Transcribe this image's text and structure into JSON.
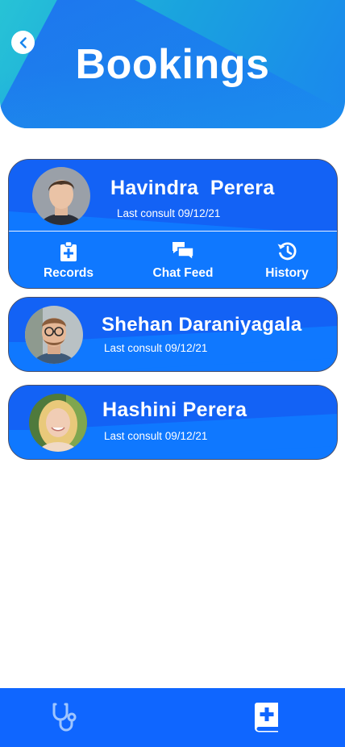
{
  "header": {
    "title": "Bookings",
    "back_icon": "chevron-left-icon"
  },
  "bookings": [
    {
      "name": "Havindra  Perera",
      "last_consult": "Last consult 09/12/21",
      "expanded": true,
      "actions": [
        {
          "label": "Records",
          "icon": "clipboard-plus-icon"
        },
        {
          "label": "Chat Feed",
          "icon": "chat-bubbles-icon"
        },
        {
          "label": "History",
          "icon": "history-icon"
        }
      ]
    },
    {
      "name": "Shehan Daraniyagala",
      "last_consult": "Last consult 09/12/21",
      "expanded": false
    },
    {
      "name": "Hashini Perera",
      "last_consult": "Last consult 09/12/21",
      "expanded": false
    }
  ],
  "bottom_nav": {
    "items": [
      {
        "icon": "stethoscope-icon"
      },
      {
        "icon": "medical-book-icon"
      }
    ]
  },
  "colors": {
    "primary": "#0f78ff",
    "primary_dark": "#1362f5",
    "header_start": "#27c3d6",
    "header_end": "#1a86ee",
    "nav": "#0f66ff",
    "icon_muted": "#9ec5ff"
  }
}
